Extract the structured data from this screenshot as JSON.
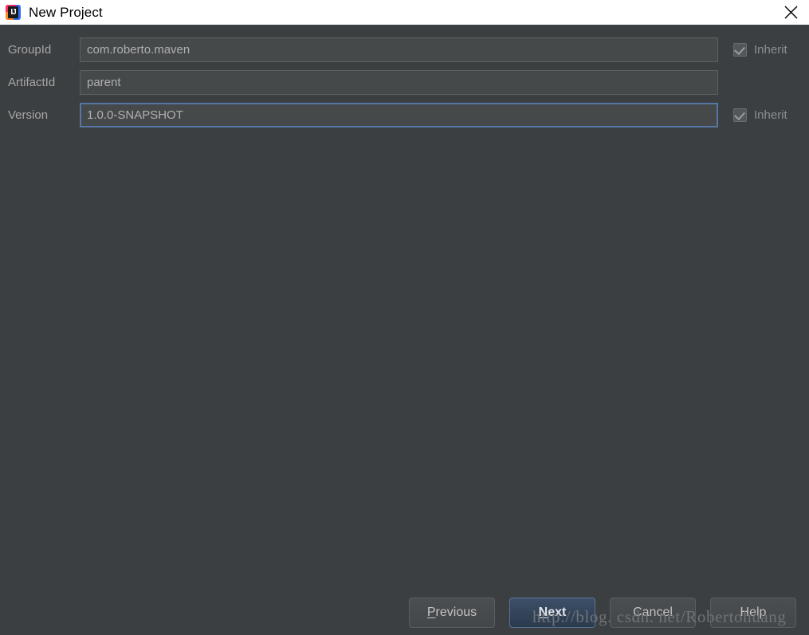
{
  "window": {
    "title": "New Project",
    "app_icon": "intellij-idea-logo",
    "close_icon": "close-icon",
    "titlebar_bg": "#ffffff",
    "body_bg": "#3c3f41"
  },
  "form": {
    "rows": [
      {
        "label": "GroupId",
        "value": "com.roberto.maven",
        "placeholder": "",
        "focused": false,
        "inherit": {
          "label": "Inherit",
          "checked": true,
          "enabled": false
        }
      },
      {
        "label": "ArtifactId",
        "value": "parent",
        "placeholder": "",
        "focused": false,
        "inherit": null
      },
      {
        "label": "Version",
        "value": "1.0.0-SNAPSHOT",
        "placeholder": "",
        "focused": true,
        "inherit": {
          "label": "Inherit",
          "checked": true,
          "enabled": false
        }
      }
    ]
  },
  "buttons": {
    "previous": {
      "label": "Previous",
      "mnemonic": "P",
      "rest": "revious",
      "default": false
    },
    "next": {
      "label": "Next",
      "mnemonic": "N",
      "rest": "ext",
      "default": true
    },
    "cancel": {
      "label": "Cancel",
      "default": false
    },
    "help": {
      "label": "Help",
      "default": false
    }
  },
  "watermark": {
    "text": "http://blog. csdn. net/Robertohuang"
  },
  "colors": {
    "accent_focus_border": "#5876a5",
    "default_button_bg": "#2b3a4d",
    "field_bg": "#45494a",
    "text_primary": "#b0b0b0",
    "label_text": "#a6a6a6"
  }
}
